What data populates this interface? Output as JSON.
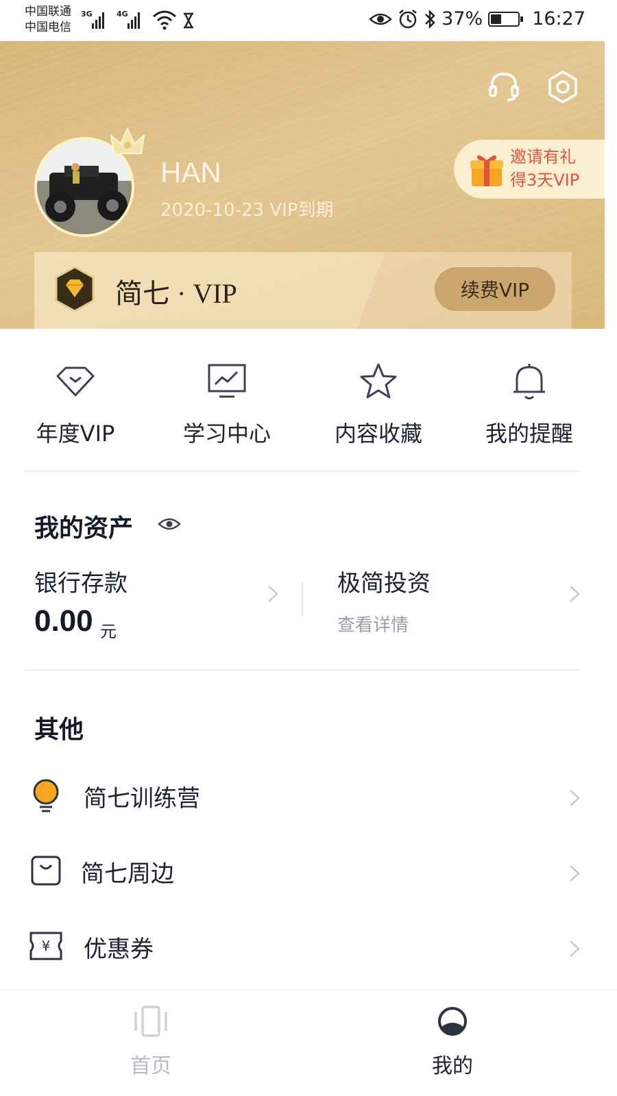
{
  "status_bar": {
    "carrier_1": "中国联通",
    "carrier_2": "中国电信",
    "net_1": "3G",
    "net_2": "4G",
    "battery": "37%",
    "time": "16:27"
  },
  "profile": {
    "username": "HAN",
    "vip_expiry": "2020-10-23 VIP到期",
    "invite_line_1": "邀请有礼",
    "invite_line_2": "得3天VIP"
  },
  "vip_card": {
    "title": "简七 · VIP",
    "renew_label": "续费VIP"
  },
  "quick_menu": [
    {
      "label": "年度VIP",
      "icon": "diamond-icon"
    },
    {
      "label": "学习中心",
      "icon": "monitor-chart-icon"
    },
    {
      "label": "内容收藏",
      "icon": "star-icon"
    },
    {
      "label": "我的提醒",
      "icon": "bell-icon"
    }
  ],
  "assets": {
    "title": "我的资产",
    "bank_label": "银行存款",
    "bank_value": "0.00",
    "bank_unit": "元",
    "invest_label": "极简投资",
    "invest_sub": "查看详情"
  },
  "other": {
    "title": "其他",
    "items": [
      {
        "label": "简七训练营",
        "icon": "lightbulb-icon"
      },
      {
        "label": "简七周边",
        "icon": "shopping-bag-icon"
      },
      {
        "label": "优惠券",
        "icon": "coupon-icon"
      }
    ]
  },
  "tabbar": {
    "home": "首页",
    "mine": "我的"
  },
  "colors": {
    "gold": "#d9b87c",
    "invite_text": "#e0543d",
    "accent_icon": "#f5a623",
    "text_dark": "#1d2233"
  }
}
